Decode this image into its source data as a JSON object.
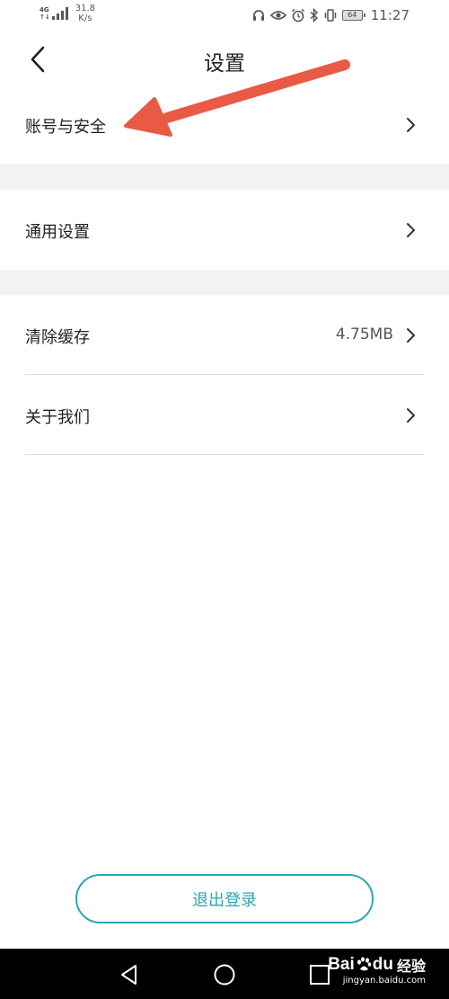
{
  "status_bar": {
    "network_type": "4G",
    "network_sub": "↑↓",
    "speed_value": "31.8",
    "speed_unit": "K/s",
    "battery": "64",
    "time": "11:27",
    "icons": [
      "headphones-icon",
      "eye-icon",
      "alarm-icon",
      "bluetooth-icon",
      "vibrate-icon",
      "battery-icon"
    ]
  },
  "header": {
    "title": "设置",
    "back_icon": "chevron-left-icon"
  },
  "rows": {
    "account_security": {
      "label": "账号与安全"
    },
    "general_settings": {
      "label": "通用设置"
    },
    "clear_cache": {
      "label": "清除缓存",
      "value": "4.75MB"
    },
    "about_us": {
      "label": "关于我们"
    }
  },
  "logout": {
    "label": "退出登录"
  },
  "colors": {
    "accent": "#2aa7ad",
    "arrow": "#e85a45",
    "section_gap": "#f2f2f2",
    "divider": "#dcdcdc",
    "nav_bar": "#000000"
  },
  "watermark": {
    "brand_a": "Bai",
    "brand_b": "du",
    "brand_cn": "经验",
    "url": "jingyan.baidu.com"
  }
}
